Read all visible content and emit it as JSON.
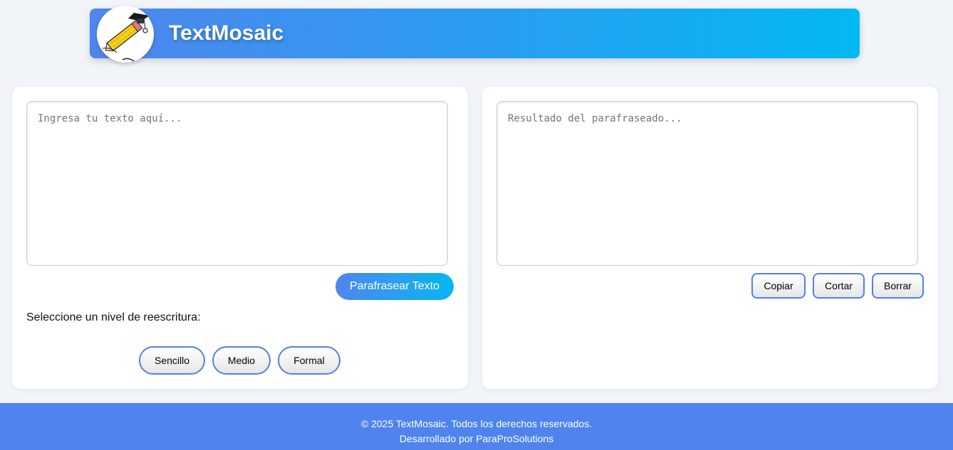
{
  "header": {
    "title": "TextMosaic",
    "logo_icon": "pencil-graduation-cap-icon"
  },
  "input_panel": {
    "textarea_placeholder": "Ingresa tu texto aquí...",
    "textarea_value": "",
    "submit_label": "Parafrasear Texto",
    "level_label": "Seleccione un nivel de reescritura:",
    "levels": [
      "Sencillo",
      "Medio",
      "Formal"
    ]
  },
  "output_panel": {
    "textarea_placeholder": "Resultado del parafraseado...",
    "textarea_value": "",
    "actions": [
      "Copiar",
      "Cortar",
      "Borrar"
    ]
  },
  "footer": {
    "copyright": "© 2025 TextMosaic. Todos los derechos reservados.",
    "credit": "Desarrollado por ParaProSolutions"
  },
  "colors": {
    "accent": "#4f86ee",
    "accent_end": "#02b9f2",
    "page_bg": "#f1f4f9",
    "footer_bg": "#4f84ee"
  }
}
